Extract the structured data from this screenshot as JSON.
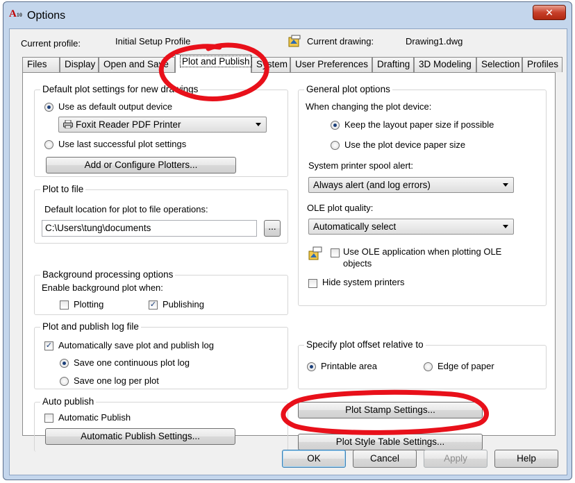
{
  "window": {
    "title": "Options",
    "app_icon_text": "A",
    "app_icon_sub": "10",
    "close_label": "✕"
  },
  "profile": {
    "current_profile_label": "Current profile:",
    "current_profile_value": "Initial Setup Profile",
    "current_drawing_label": "Current drawing:",
    "current_drawing_value": "Drawing1.dwg"
  },
  "tabs": [
    "Files",
    "Display",
    "Open and Save",
    "Plot and Publish",
    "System",
    "User Preferences",
    "Drafting",
    "3D Modeling",
    "Selection",
    "Profiles"
  ],
  "default_plot": {
    "title": "Default plot settings for new drawings",
    "use_default_label": "Use as default output device",
    "device_value": "Foxit Reader PDF Printer",
    "use_last_label": "Use last successful plot settings",
    "add_configure_label": "Add or Configure Plotters..."
  },
  "plot_to_file": {
    "title": "Plot to file",
    "location_label": "Default location for plot to file operations:",
    "location_value": "C:\\Users\\tung\\documents",
    "browse_label": "..."
  },
  "background": {
    "title": "Background processing options",
    "enable_label": "Enable background plot when:",
    "plotting_label": "Plotting",
    "publishing_label": "Publishing",
    "publishing_checked": "✓"
  },
  "log": {
    "title": "Plot and publish log file",
    "auto_save_label": "Automatically save plot and publish log",
    "auto_save_checked": "✓",
    "continuous_label": "Save one continuous plot log",
    "per_plot_label": "Save one log per plot"
  },
  "auto_publish": {
    "title": "Auto publish",
    "automatic_label": "Automatic Publish",
    "settings_label": "Automatic Publish Settings..."
  },
  "general": {
    "title": "General plot options",
    "changing_label": "When changing the plot device:",
    "keep_label": "Keep the layout paper size if possible",
    "use_device_label": "Use the plot device paper size",
    "spool_label": "System printer spool alert:",
    "spool_value": "Always alert (and log errors)",
    "ole_quality_label": "OLE plot quality:",
    "ole_quality_value": "Automatically select",
    "use_ole_label_1": "Use OLE application when plotting OLE",
    "use_ole_label_2": "objects",
    "hide_label": "Hide system printers"
  },
  "offset": {
    "title": "Specify plot offset relative to",
    "printable_label": "Printable area",
    "edge_label": "Edge of paper"
  },
  "buttons": {
    "stamp_label": "Plot Stamp Settings...",
    "style_table_label": "Plot Style Table Settings...",
    "ok_label": "OK",
    "cancel_label": "Cancel",
    "apply_label": "Apply",
    "help_label": "Help"
  },
  "colors": {
    "annotation": "#e8101a",
    "window_frame": "#c4d6ec",
    "selected_radio": "#1b3f7a"
  }
}
